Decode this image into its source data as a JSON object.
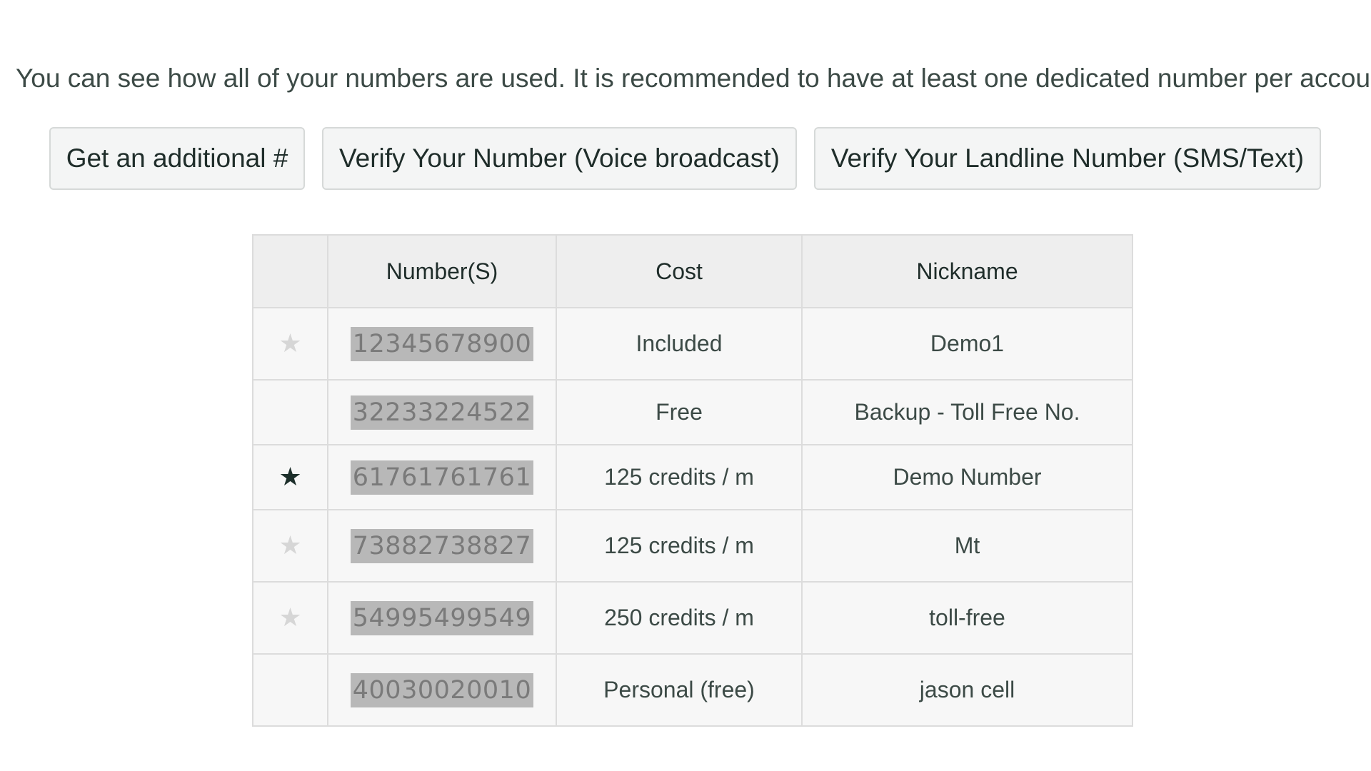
{
  "intro_text": "You can see how all of your numbers are used. It is recommended to have at least one dedicated number per account.",
  "buttons": {
    "add_number": "Get an additional #",
    "verify_voice": "Verify Your Number (Voice broadcast)",
    "verify_sms": "Verify Your Landline Number (SMS/Text)"
  },
  "table": {
    "headers": {
      "star": "",
      "number": "Number(S)",
      "cost": "Cost",
      "nickname": "Nickname"
    },
    "rows": [
      {
        "star": "inactive",
        "star_glyph": "★",
        "number": "12345678900",
        "cost": "Included",
        "nickname": "Demo1"
      },
      {
        "star": "none",
        "star_glyph": "",
        "number": "32233224522",
        "cost": "Free",
        "nickname": "Backup - Toll Free No."
      },
      {
        "star": "active",
        "star_glyph": "★",
        "number": "61761761761",
        "cost": "125 credits / m",
        "nickname": "Demo Number"
      },
      {
        "star": "inactive",
        "star_glyph": "★",
        "number": "73882738827",
        "cost": "125 credits / m",
        "nickname": "Mt"
      },
      {
        "star": "inactive",
        "star_glyph": "★",
        "number": "54995499549",
        "cost": "250 credits / m",
        "nickname": "toll-free"
      },
      {
        "star": "none",
        "star_glyph": "",
        "number": "40030020010",
        "cost": "Personal (free)",
        "nickname": "jason cell"
      }
    ]
  },
  "colors": {
    "star_active": "#1d2f2b",
    "star_inactive": "#d6d6d6",
    "number_highlight": "#b8b8b8"
  },
  "icons": {
    "star": "star-icon"
  }
}
